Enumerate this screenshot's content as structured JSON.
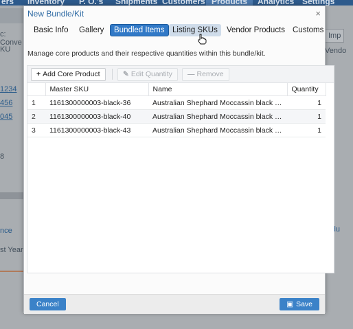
{
  "background": {
    "nav_items": [
      "ers",
      "Inventory",
      "P. O.'s",
      "Shipments",
      "Customers",
      "Products",
      "Analytics",
      "Settings"
    ],
    "left_items": [
      "c: Conve",
      "KU",
      "1234",
      "456",
      "045",
      "8",
      "nce",
      "st Year"
    ],
    "right_items": [
      "Imp",
      "Vendo",
      "rodu"
    ]
  },
  "modal": {
    "title": "New Bundle/Kit",
    "close": "×",
    "tabs": [
      "Basic Info",
      "Gallery",
      "Bundled Items",
      "Listing SKUs",
      "Vendor Products",
      "Customs"
    ],
    "active_tab": "Bundled Items",
    "description": "Manage core products and their respective quantities within this bundle/kit.",
    "toolbar": {
      "add_label": "Add Core Product",
      "add_icon": "+",
      "edit_label": "Edit Quantity",
      "edit_icon": "✎",
      "remove_label": "Remove",
      "remove_icon": "—"
    },
    "table": {
      "columns": [
        "Master SKU",
        "Name",
        "Quantity"
      ],
      "rows": [
        {
          "n": "1",
          "sku": "1161300000003-black-36",
          "name": "Australian Shephard Moccassin black M...",
          "qty": "1"
        },
        {
          "n": "2",
          "sku": "1161300000003-black-40",
          "name": "Australian Shephard Moccassin black M...",
          "qty": "1"
        },
        {
          "n": "3",
          "sku": "1161300000003-black-43",
          "name": "Australian Shephard Moccassin black M...",
          "qty": "1"
        }
      ]
    },
    "footer": {
      "cancel": "Cancel",
      "save": "Save",
      "save_icon": "▣"
    }
  },
  "colors": {
    "accent": "#3179c7",
    "title": "#2e6aa3"
  }
}
